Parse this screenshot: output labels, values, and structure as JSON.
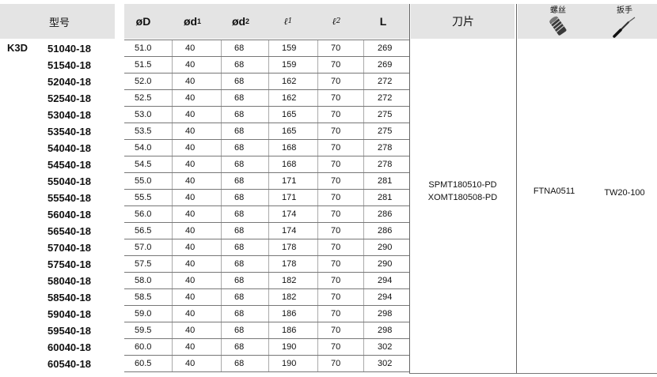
{
  "header": {
    "model": "型号",
    "od": "øD",
    "od1": "ød",
    "od1_sub": "1",
    "od2": "ød",
    "od2_sub": "2",
    "l1": "ℓ",
    "l1_sub": "1",
    "l2": "ℓ",
    "l2_sub": "2",
    "L": "L",
    "insert": "刀片",
    "screw_label": "螺丝",
    "wrench_label": "扳手",
    "screw_icon": "screw-icon",
    "wrench_icon": "wrench-icon"
  },
  "prefix": "K3D",
  "rows": [
    {
      "code": "51040-18",
      "od": "51.0",
      "d1": "40",
      "d2": "68",
      "l1": "159",
      "l2": "70",
      "L": "269"
    },
    {
      "code": "51540-18",
      "od": "51.5",
      "d1": "40",
      "d2": "68",
      "l1": "159",
      "l2": "70",
      "L": "269"
    },
    {
      "code": "52040-18",
      "od": "52.0",
      "d1": "40",
      "d2": "68",
      "l1": "162",
      "l2": "70",
      "L": "272"
    },
    {
      "code": "52540-18",
      "od": "52.5",
      "d1": "40",
      "d2": "68",
      "l1": "162",
      "l2": "70",
      "L": "272"
    },
    {
      "code": "53040-18",
      "od": "53.0",
      "d1": "40",
      "d2": "68",
      "l1": "165",
      "l2": "70",
      "L": "275"
    },
    {
      "code": "53540-18",
      "od": "53.5",
      "d1": "40",
      "d2": "68",
      "l1": "165",
      "l2": "70",
      "L": "275"
    },
    {
      "code": "54040-18",
      "od": "54.0",
      "d1": "40",
      "d2": "68",
      "l1": "168",
      "l2": "70",
      "L": "278"
    },
    {
      "code": "54540-18",
      "od": "54.5",
      "d1": "40",
      "d2": "68",
      "l1": "168",
      "l2": "70",
      "L": "278"
    },
    {
      "code": "55040-18",
      "od": "55.0",
      "d1": "40",
      "d2": "68",
      "l1": "171",
      "l2": "70",
      "L": "281"
    },
    {
      "code": "55540-18",
      "od": "55.5",
      "d1": "40",
      "d2": "68",
      "l1": "171",
      "l2": "70",
      "L": "281"
    },
    {
      "code": "56040-18",
      "od": "56.0",
      "d1": "40",
      "d2": "68",
      "l1": "174",
      "l2": "70",
      "L": "286"
    },
    {
      "code": "56540-18",
      "od": "56.5",
      "d1": "40",
      "d2": "68",
      "l1": "174",
      "l2": "70",
      "L": "286"
    },
    {
      "code": "57040-18",
      "od": "57.0",
      "d1": "40",
      "d2": "68",
      "l1": "178",
      "l2": "70",
      "L": "290"
    },
    {
      "code": "57540-18",
      "od": "57.5",
      "d1": "40",
      "d2": "68",
      "l1": "178",
      "l2": "70",
      "L": "290"
    },
    {
      "code": "58040-18",
      "od": "58.0",
      "d1": "40",
      "d2": "68",
      "l1": "182",
      "l2": "70",
      "L": "294"
    },
    {
      "code": "58540-18",
      "od": "58.5",
      "d1": "40",
      "d2": "68",
      "l1": "182",
      "l2": "70",
      "L": "294"
    },
    {
      "code": "59040-18",
      "od": "59.0",
      "d1": "40",
      "d2": "68",
      "l1": "186",
      "l2": "70",
      "L": "298"
    },
    {
      "code": "59540-18",
      "od": "59.5",
      "d1": "40",
      "d2": "68",
      "l1": "186",
      "l2": "70",
      "L": "298"
    },
    {
      "code": "60040-18",
      "od": "60.0",
      "d1": "40",
      "d2": "68",
      "l1": "190",
      "l2": "70",
      "L": "302"
    },
    {
      "code": "60540-18",
      "od": "60.5",
      "d1": "40",
      "d2": "68",
      "l1": "190",
      "l2": "70",
      "L": "302"
    }
  ],
  "insert_values": [
    "SPMT180510-PD",
    "XOMT180508-PD"
  ],
  "screw_value": "FTNA0511",
  "wrench_value": "TW20-100"
}
